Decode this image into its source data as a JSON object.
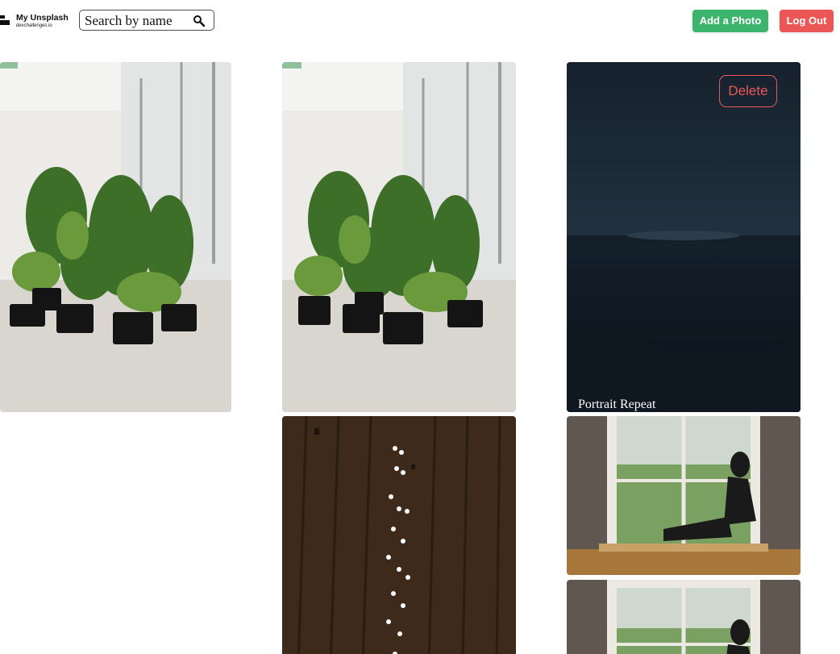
{
  "header": {
    "logo_title": "My Unsplash",
    "logo_subtitle": "devchallenges.io",
    "search_placeholder": "Search by name",
    "add_photo_label": "Add a Photo",
    "logout_label": "Log Out"
  },
  "gallery": {
    "hovered_photo": {
      "delete_label": "Delete",
      "caption": "Portrait Repeat"
    }
  },
  "colors": {
    "add_button": "#3db46d",
    "logout_button": "#eb5757",
    "delete_outline": "#eb5757"
  }
}
